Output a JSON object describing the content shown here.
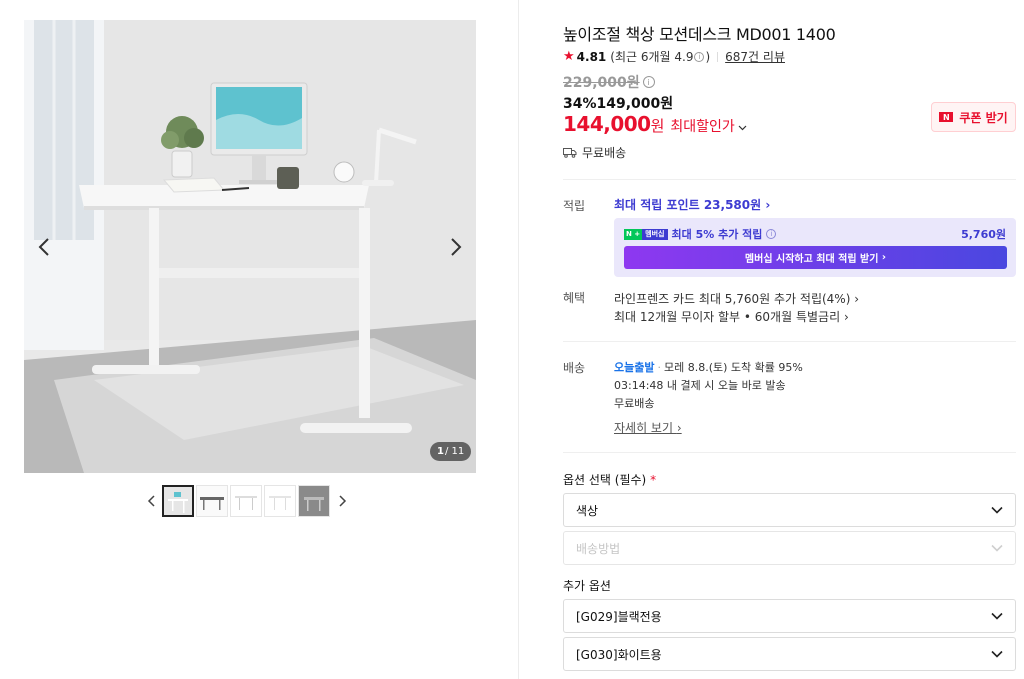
{
  "gallery": {
    "current": "1",
    "total": "/ 11",
    "thumb_count": 5,
    "active_thumb": 0
  },
  "product": {
    "title": "높이조절 책상 모션데스크 MD001 1400",
    "rating": "4.81",
    "recent_rating": "(최근 6개월 4.9",
    "recent_close": ")",
    "review_count": "687건 리뷰",
    "original_price": "229,000원",
    "discount_line": "34%149,000원",
    "max_price": "144,000",
    "max_price_unit": "원",
    "max_price_label": "최대할인가",
    "coupon_label": "쿠폰 받기",
    "coupon_badge": "N",
    "shipping": "무료배송"
  },
  "points": {
    "label": "적립",
    "max_points": "최대 적립 포인트 23,580원",
    "membership_text": "최대 5% 추가 적립",
    "membership_badge_n": "N +",
    "membership_badge_p": "멤버십",
    "membership_amount": "5,760원",
    "membership_button": "멤버십 시작하고 최대 적립 받기"
  },
  "benefits": {
    "label": "혜택",
    "card": "라인프렌즈 카드 최대 5,760원 추가 적립(4%)",
    "installment": "최대 12개월 무이자 할부 • 60개월 특별금리"
  },
  "delivery": {
    "label": "배송",
    "today": "오늘출발",
    "arrival": "모레 8.8.(토) 도착 확률 95%",
    "timer": "03:14:48  내 결제 시 오늘 바로 발송",
    "fee": "무료배송",
    "more": "자세히 보기"
  },
  "options": {
    "title": "옵션 선택 (필수)",
    "required_mark": "*",
    "color_select": "색상",
    "shipping_select": "배송방법",
    "extra_title": "추가 옵션",
    "extra_1": "[G029]블랙전용",
    "extra_2": "[G030]화이트용"
  },
  "colors": {
    "accent_red": "#e8102e",
    "points_purple": "#3d3bd1",
    "today_blue": "#1a73e8"
  }
}
